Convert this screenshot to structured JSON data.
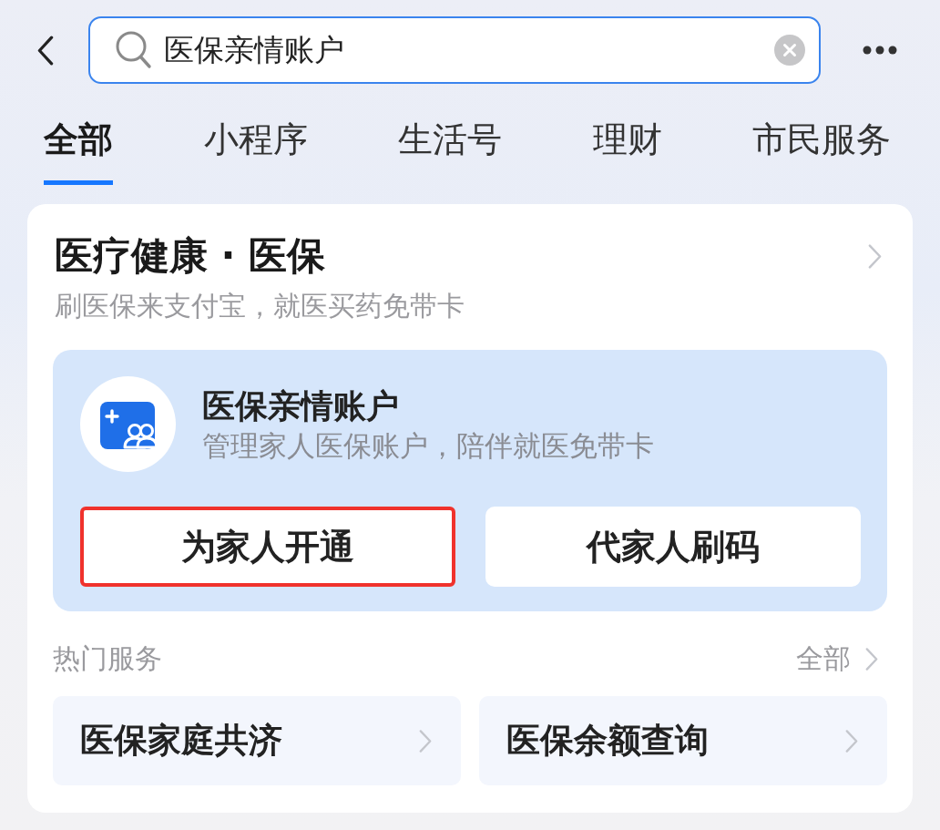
{
  "header": {
    "search": {
      "value": "医保亲情账户"
    }
  },
  "tabs": [
    {
      "label": "全部",
      "selected": true
    },
    {
      "label": "小程序",
      "selected": false
    },
    {
      "label": "生活号",
      "selected": false
    },
    {
      "label": "理财",
      "selected": false
    },
    {
      "label": "市民服务",
      "selected": false
    }
  ],
  "card": {
    "title": "医疗健康 · 医保",
    "subtitle": "刷医保来支付宝，就医买药免带卡",
    "feature": {
      "title": "医保亲情账户",
      "description": "管理家人医保账户，陪伴就医免带卡",
      "buttons": [
        {
          "label": "为家人开通",
          "highlighted": true
        },
        {
          "label": "代家人刷码",
          "highlighted": false
        }
      ]
    },
    "hot_services": {
      "title": "热门服务",
      "more": "全部",
      "items": [
        {
          "label": "医保家庭共济"
        },
        {
          "label": "医保余额查询"
        }
      ]
    }
  }
}
